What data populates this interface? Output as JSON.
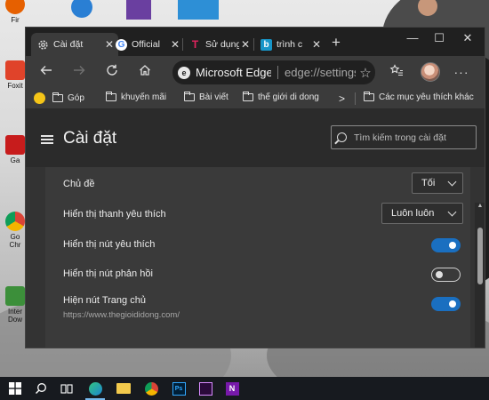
{
  "desktop": {
    "icons": [
      {
        "label": "Fir",
        "color": "#e66000"
      },
      {
        "label": "Foxit",
        "color": "#e0432a"
      },
      {
        "label": "Ga",
        "color": "#c71c1c"
      },
      {
        "label": "Go\nChr",
        "color": "#2a9d4b"
      },
      {
        "label": "Inter\nDow",
        "color": "#3c8f3a"
      }
    ]
  },
  "browser": {
    "tabs": [
      {
        "icon": "gear-icon",
        "label": "Cài đặt",
        "close": "✕"
      },
      {
        "icon": "google-icon",
        "label": "Official",
        "close": "✕"
      },
      {
        "icon": "t-icon",
        "label": "Sử dụng",
        "close": "✕"
      },
      {
        "icon": "bing-icon",
        "label": "trình c",
        "close": "✕"
      }
    ],
    "new_tab": "+",
    "window_controls": {
      "minimize": "—",
      "maximize": "☐",
      "close": "✕"
    },
    "address": {
      "site": "Microsoft Edge",
      "url": "edge://settings/appearance"
    },
    "favorites": [
      {
        "label": "Góp"
      },
      {
        "label": "khuyến mãi"
      },
      {
        "label": "Bài viết"
      },
      {
        "label": "thế giới di dong"
      }
    ],
    "favorites_more": ">",
    "favorites_other": "Các mục yêu thích khác"
  },
  "settings": {
    "title": "Cài đặt",
    "search_placeholder": "Tìm kiếm trong cài đặt",
    "rows": [
      {
        "label": "Chủ đề",
        "control": "dropdown",
        "value": "Tối"
      },
      {
        "label": "Hiển thị thanh yêu thích",
        "control": "dropdown",
        "value": "Luôn luôn"
      },
      {
        "label": "Hiển thị nút yêu thích",
        "control": "toggle",
        "on": true
      },
      {
        "label": "Hiển thị nút phản hồi",
        "control": "toggle",
        "on": false
      },
      {
        "label": "Hiện nút Trang chủ",
        "control": "toggle",
        "on": true,
        "sub": "https://www.thegioididong.com/"
      }
    ]
  },
  "colors": {
    "accent": "#1a6fc0",
    "settings_bg": "#333333",
    "panel_bg": "#3a3a3a"
  }
}
